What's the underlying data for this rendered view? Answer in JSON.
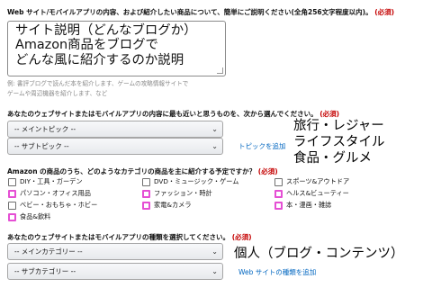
{
  "q1": {
    "label": "Web サイト/モバイルアプリの内容、および紹介したい商品について、簡単にご説明ください(全角256文字程度以内)。",
    "required": "(必須)",
    "value_lines": [
      "サイト説明（どんなブログか）",
      "Amazon商品をブログで",
      "どんな風に紹介するのか説明"
    ],
    "example_lines": [
      "例: 書評ブログで読んだ本を紹介します、ゲームの攻略情報サイトで",
      "ゲームや周辺機器を紹介します、など"
    ]
  },
  "q2": {
    "label": "あなたのウェブサイトまたはモバイルアプリの内容に最も近いと思うものを、次から選んでください。",
    "required": "(必須)",
    "main_topic": "-- メイントピック --",
    "sub_topic": "-- サブトピック --",
    "add_topic_link": "トピックを追加",
    "annotation_lines": [
      "旅行・レジャー",
      "ライフスタイル",
      "食品・グルメ"
    ]
  },
  "q3": {
    "label": "Amazon の商品のうち、どのようなカテゴリの商品を主に紹介する予定ですか？",
    "required": "(必須)",
    "categories": [
      {
        "label": "DIY・工具・ガーデン",
        "checked": false
      },
      {
        "label": "DVD・ミュージック・ゲーム",
        "checked": false
      },
      {
        "label": "スポーツ&アウトドア",
        "checked": false
      },
      {
        "label": "パソコン・オフィス用品",
        "checked": true
      },
      {
        "label": "ファッション・時計",
        "checked": true
      },
      {
        "label": "ヘルス&ビューティー",
        "checked": true
      },
      {
        "label": "ベビー・おもちゃ・ホビー",
        "checked": false
      },
      {
        "label": "家電&カメラ",
        "checked": true
      },
      {
        "label": "本・漫画・雑誌",
        "checked": true
      },
      {
        "label": "食品&飲料",
        "checked": true
      }
    ]
  },
  "q4": {
    "label": "あなたのウェブサイトまたはモバイルアプリの種類を選択してください。",
    "required": "(必須)",
    "main_category": "-- メインカテゴリー --",
    "sub_category": "-- サブカテゴリー --",
    "add_type_link": "Web サイトの種類を追加",
    "annotation": "個人（ブログ・コンテンツ）"
  }
}
